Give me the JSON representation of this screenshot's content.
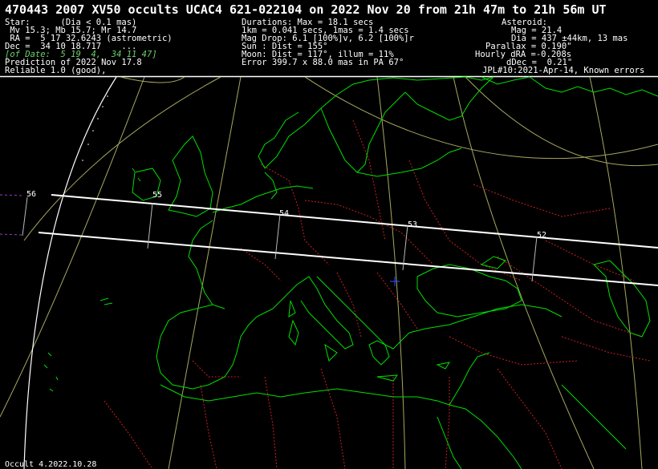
{
  "title": "470443 2007 XV50 occults UCAC4 621-022104 on 2022 Nov 20 from 21h 47m to 21h 56m UT",
  "left_column": {
    "star_header": "Star:      (Dia < 0.1 mas)",
    "mags": " Mv 15.3; Mb 15.7; Mr 14.7",
    "ra": " RA =  5 17 32.6243 (astrometric)",
    "dec": "Dec =  34 10 18.717    ...",
    "of_date": "[of Date:  5 19  4,  34 11 47]",
    "prediction": "Prediction of 2022 Nov 17.8",
    "reliable": "Reliable 1.0 (good),"
  },
  "middle_column": {
    "durations": "Durations: Max = 18.1 secs",
    "scale": "1km = 0.041 secs, 1mas = 1.4 secs",
    "mag_drop": "Mag Drop: 6.1 [100%]v, 6.2 [100%]r",
    "sun": "Sun : Dist = 155°",
    "moon": "Moon: Dist = 117°, illum = 11%",
    "error": "Error 399.7 x 88.0 mas in PA 67°"
  },
  "right_column": {
    "asteroid_header": "Asteroid:",
    "mag": "Mag = 21.4",
    "dia": "Dia = 437 ±44km, 13 mas",
    "parallax": "Parallax = 0.190\"",
    "hourly_dra": "Hourly dRA =-0.208s",
    "ddec": "dDec =  0.21\"",
    "jpl": "JPL#10:2021-Apr-14, Known errors"
  },
  "footer": "Occult 4.2022.10.28",
  "time_labels": [
    "56",
    "55",
    "54",
    "53",
    "52"
  ],
  "colors": {
    "background": "#000000",
    "coastline": "#00e000",
    "borders": "#d02020",
    "graticule": "#a8a860",
    "path": "#ffffff",
    "center_marker": "#3050ff"
  }
}
